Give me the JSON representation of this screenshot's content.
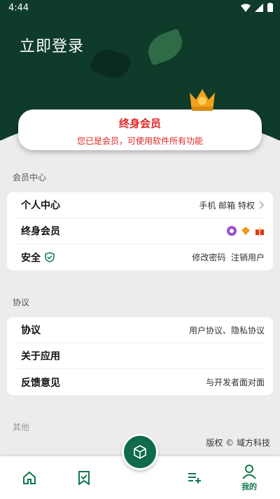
{
  "status_bar": {
    "time": "4:44"
  },
  "header": {
    "login_label": "立即登录"
  },
  "vip_card": {
    "title": "终身会员",
    "subtitle": "您已是会员，可使用软件所有功能"
  },
  "section_member": {
    "title": "会员中心",
    "rows": [
      {
        "label": "个人中心",
        "right": "手机 邮箱 特权"
      },
      {
        "label": "终身会员",
        "right": ""
      },
      {
        "label": "安全",
        "right": "修改密码  注销用户"
      }
    ]
  },
  "section_agreement": {
    "title": "协议",
    "rows": [
      {
        "label": "协议",
        "right": "用户协议、隐私协议"
      },
      {
        "label": "关于应用",
        "right": ""
      },
      {
        "label": "反馈意见",
        "right": "与开发者面对面"
      }
    ]
  },
  "section_other": {
    "title": "其他"
  },
  "copyright": "版权 © 域方科技",
  "tabbar": {
    "mine_label": "我的"
  },
  "colors": {
    "header": "#0f3b2a",
    "accent": "#0f6b4a",
    "vip_red": "#e02424"
  }
}
